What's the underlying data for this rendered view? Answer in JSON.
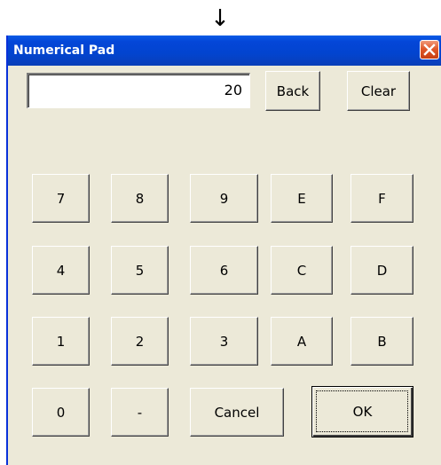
{
  "arrow_glyph": "↓",
  "window": {
    "title": "Numerical Pad"
  },
  "display": {
    "value": "20"
  },
  "buttons": {
    "back": "Back",
    "clear": "Clear",
    "k7": "7",
    "k8": "8",
    "k9": "9",
    "kE": "E",
    "kF": "F",
    "k4": "4",
    "k5": "5",
    "k6": "6",
    "kC": "C",
    "kD": "D",
    "k1": "1",
    "k2": "2",
    "k3": "3",
    "kA": "A",
    "kB": "B",
    "k0": "0",
    "minus": "-",
    "cancel": "Cancel",
    "ok": "OK"
  },
  "icons": {
    "close": "close-icon",
    "arrow": "down-arrow-icon"
  }
}
